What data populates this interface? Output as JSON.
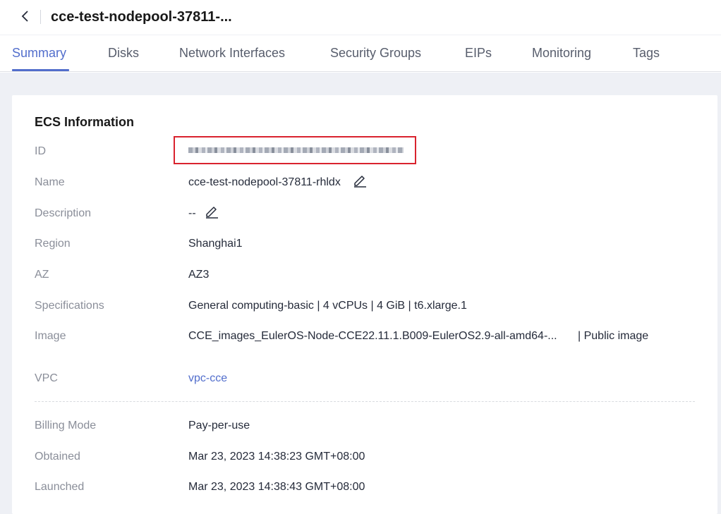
{
  "header": {
    "title": "cce-test-nodepool-37811-..."
  },
  "tabs": [
    {
      "label": "Summary",
      "active": true
    },
    {
      "label": "Disks"
    },
    {
      "label": "Network Interfaces"
    },
    {
      "label": "Security Groups"
    },
    {
      "label": "EIPs"
    },
    {
      "label": "Monitoring"
    },
    {
      "label": "Tags"
    }
  ],
  "ecs": {
    "title": "ECS Information",
    "id_label": "ID",
    "name_label": "Name",
    "name_value": "cce-test-nodepool-37811-rhldx",
    "description_label": "Description",
    "description_value": "--",
    "region_label": "Region",
    "region_value": "Shanghai1",
    "az_label": "AZ",
    "az_value": "AZ3",
    "specs_label": "Specifications",
    "specs_value": "General computing-basic | 4 vCPUs | 4 GiB | t6.xlarge.1",
    "image_label": "Image",
    "image_value": "CCE_images_EulerOS-Node-CCE22.11.1.B009-EulerOS2.9-all-amd64-...",
    "image_type": "| Public image",
    "vpc_label": "VPC",
    "vpc_value": "vpc-cce",
    "billing_label": "Billing Mode",
    "billing_value": "Pay-per-use",
    "obtained_label": "Obtained",
    "obtained_value": "Mar 23, 2023 14:38:23 GMT+08:00",
    "launched_label": "Launched",
    "launched_value": "Mar 23, 2023 14:38:43 GMT+08:00"
  },
  "colors": {
    "accent": "#526ecc",
    "highlight_box": "#d9232e",
    "label": "#8a8e99",
    "background": "#eef0f5"
  }
}
